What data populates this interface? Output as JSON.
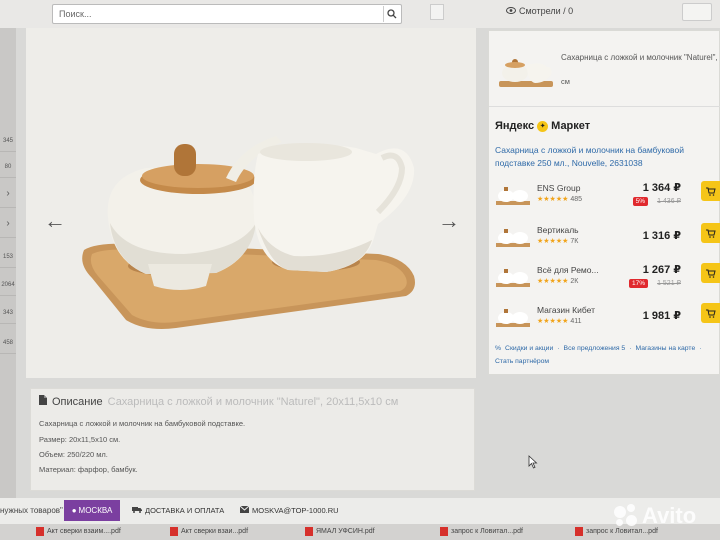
{
  "search": {
    "placeholder": "Поиск..."
  },
  "header": {
    "viewed": "Смотрели / 0"
  },
  "left_strip": {
    "values": [
      "345",
      "80",
      "153",
      "2064",
      "343",
      "458"
    ]
  },
  "product": {
    "prev_arrow": "←",
    "next_arrow": "→"
  },
  "description": {
    "title": "Описание",
    "subtitle": "Сахарница с ложкой и молочник \"Naturel\", 20х11,5х10 см",
    "lines": [
      "Сахарница с ложкой и молочник на бамбуковой подставке.",
      "Размер: 20х11,5х10 см.",
      "Объем: 250/220 мл.",
      " Материал: фарфор, бамбук."
    ]
  },
  "market": {
    "top_title": "Сахарница с ложкой и молочник \"Naturel\", 2...",
    "top_unit": "см",
    "brand": "Яндекс",
    "brand2": "Маркет",
    "product_desc": "Сахарница с ложкой и молочник на бамбуковой подставке 250 мл., Nouvelle, 2631038",
    "offers": [
      {
        "shop": "ENS Group",
        "rating": "★★★★★",
        "reviews": "485",
        "price": "1 364 ₽",
        "discount": "5%",
        "old_price": "1 436 ₽"
      },
      {
        "shop": "Вертикаль",
        "rating": "★★★★★",
        "reviews": "7К",
        "price": "1 316 ₽",
        "discount": "",
        "old_price": ""
      },
      {
        "shop": "Всё для Ремо...",
        "rating": "★★★★★",
        "reviews": "2К",
        "price": "1 267 ₽",
        "discount": "17%",
        "old_price": "1 521 ₽"
      },
      {
        "shop": "Магазин Кибет",
        "rating": "★★★★★",
        "reviews": "411",
        "price": "1 981 ₽",
        "discount": "",
        "old_price": ""
      }
    ],
    "links": [
      "Скидки и акции",
      "·",
      "Все предложения 5",
      "·",
      "Магазины на карте",
      "·"
    ],
    "partner": "Стать партнёром"
  },
  "bottom": {
    "needed": "нужных товаров\"",
    "city": "МОСКВА",
    "delivery": "ДОСТАВКА И ОПЛАТА",
    "email": "MOSKVA@TOP-1000.RU"
  },
  "taskbar": [
    "Акт сверки взаим....pdf",
    "Акт сверки взаи...pdf",
    "ЯМАЛ УФСИН.pdf",
    "запрос к Ловитал...pdf",
    "запрос к Ловитал...pdf"
  ],
  "watermark": "Avito",
  "colors": {
    "purple": "#7b3fa0",
    "yellow": "#f5c518",
    "link": "#2f6aa8",
    "red": "#e0292e"
  }
}
